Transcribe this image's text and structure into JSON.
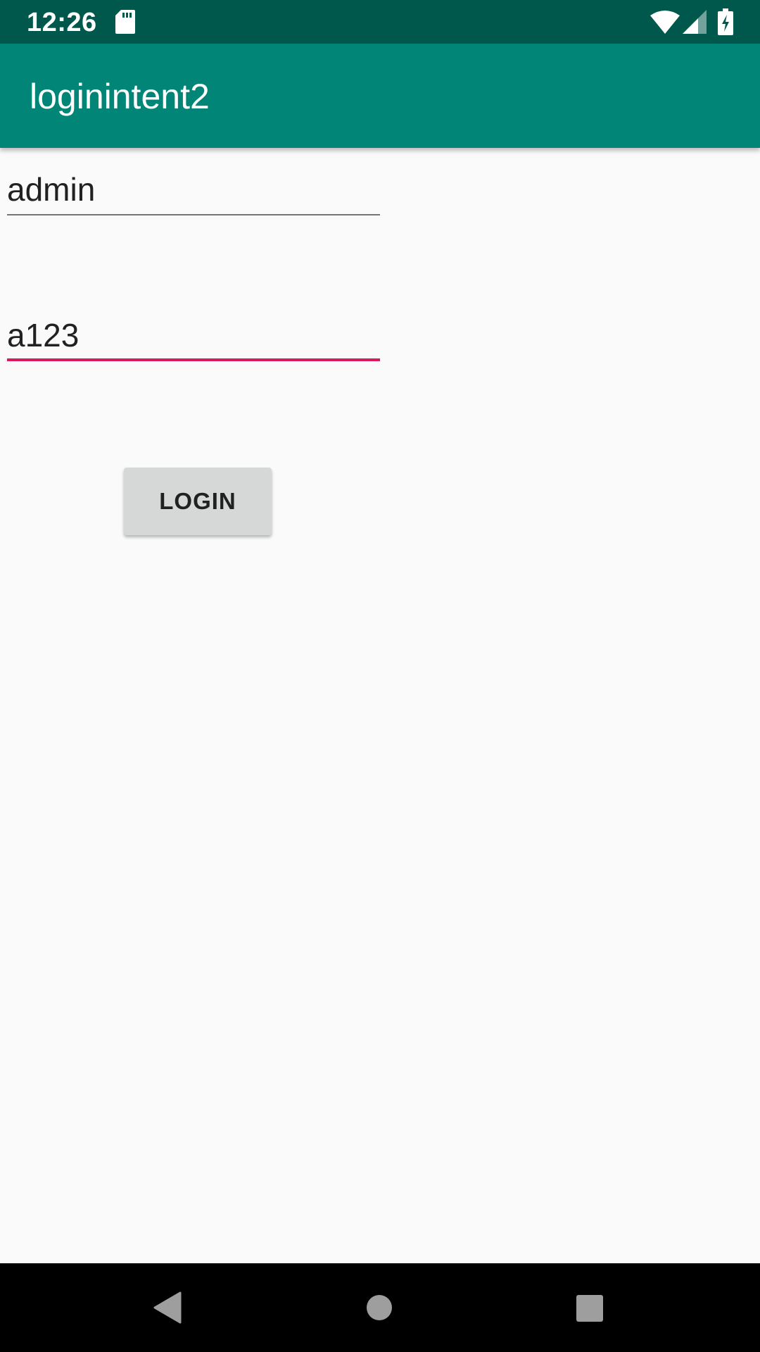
{
  "status_bar": {
    "time": "12:26",
    "icons": [
      "sd-card-icon",
      "wifi-icon",
      "signal-icon",
      "battery-charging-icon"
    ]
  },
  "app_bar": {
    "title": "loginintent2"
  },
  "form": {
    "username_value": "admin",
    "password_value": "a123",
    "login_label": "LOGIN"
  },
  "nav_bar": {
    "icons": [
      "back-icon",
      "home-icon",
      "recents-icon"
    ]
  },
  "colors": {
    "status_bar": "#00574b",
    "app_bar": "#008577",
    "accent": "#d81b60",
    "background": "#fafafa",
    "button": "#d6d7d7"
  }
}
